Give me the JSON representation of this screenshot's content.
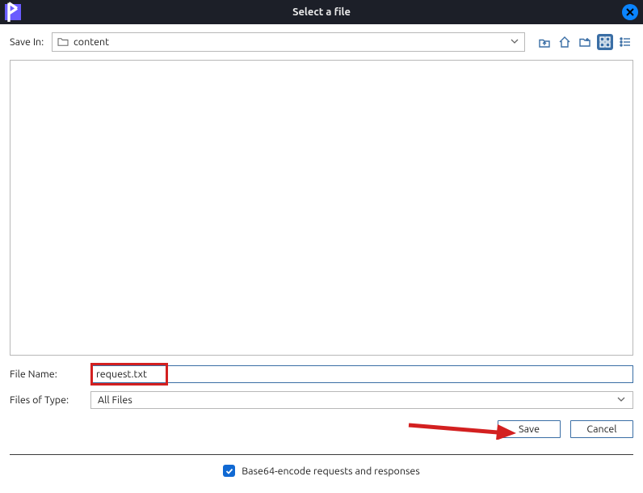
{
  "window": {
    "title": "Select a file"
  },
  "saveIn": {
    "label": "Save In:",
    "path": "content"
  },
  "fileName": {
    "label": "File Name:",
    "value": "request.txt"
  },
  "fileType": {
    "label": "Files of Type:",
    "selected": "All Files"
  },
  "buttons": {
    "save": "Save",
    "cancel": "Cancel"
  },
  "footer": {
    "checkbox_label": "Base64-encode requests and responses",
    "checked": true
  },
  "toolbar_icons": {
    "up": "up-folder-icon",
    "home": "home-icon",
    "new_folder": "new-folder-icon",
    "grid_view": "grid-view-icon",
    "list_view": "list-view-icon"
  }
}
